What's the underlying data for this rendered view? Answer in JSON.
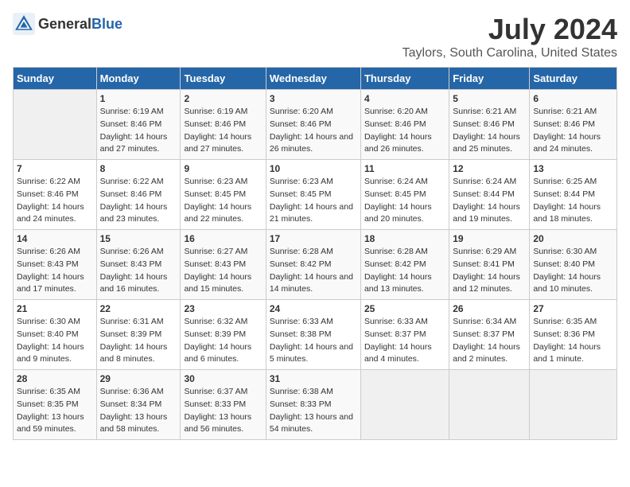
{
  "header": {
    "logo_general": "General",
    "logo_blue": "Blue",
    "title": "July 2024",
    "subtitle": "Taylors, South Carolina, United States"
  },
  "calendar": {
    "days_of_week": [
      "Sunday",
      "Monday",
      "Tuesday",
      "Wednesday",
      "Thursday",
      "Friday",
      "Saturday"
    ],
    "weeks": [
      [
        {
          "day": "",
          "sunrise": "",
          "sunset": "",
          "daylight": ""
        },
        {
          "day": "1",
          "sunrise": "Sunrise: 6:19 AM",
          "sunset": "Sunset: 8:46 PM",
          "daylight": "Daylight: 14 hours and 27 minutes."
        },
        {
          "day": "2",
          "sunrise": "Sunrise: 6:19 AM",
          "sunset": "Sunset: 8:46 PM",
          "daylight": "Daylight: 14 hours and 27 minutes."
        },
        {
          "day": "3",
          "sunrise": "Sunrise: 6:20 AM",
          "sunset": "Sunset: 8:46 PM",
          "daylight": "Daylight: 14 hours and 26 minutes."
        },
        {
          "day": "4",
          "sunrise": "Sunrise: 6:20 AM",
          "sunset": "Sunset: 8:46 PM",
          "daylight": "Daylight: 14 hours and 26 minutes."
        },
        {
          "day": "5",
          "sunrise": "Sunrise: 6:21 AM",
          "sunset": "Sunset: 8:46 PM",
          "daylight": "Daylight: 14 hours and 25 minutes."
        },
        {
          "day": "6",
          "sunrise": "Sunrise: 6:21 AM",
          "sunset": "Sunset: 8:46 PM",
          "daylight": "Daylight: 14 hours and 24 minutes."
        }
      ],
      [
        {
          "day": "7",
          "sunrise": "Sunrise: 6:22 AM",
          "sunset": "Sunset: 8:46 PM",
          "daylight": "Daylight: 14 hours and 24 minutes."
        },
        {
          "day": "8",
          "sunrise": "Sunrise: 6:22 AM",
          "sunset": "Sunset: 8:46 PM",
          "daylight": "Daylight: 14 hours and 23 minutes."
        },
        {
          "day": "9",
          "sunrise": "Sunrise: 6:23 AM",
          "sunset": "Sunset: 8:45 PM",
          "daylight": "Daylight: 14 hours and 22 minutes."
        },
        {
          "day": "10",
          "sunrise": "Sunrise: 6:23 AM",
          "sunset": "Sunset: 8:45 PM",
          "daylight": "Daylight: 14 hours and 21 minutes."
        },
        {
          "day": "11",
          "sunrise": "Sunrise: 6:24 AM",
          "sunset": "Sunset: 8:45 PM",
          "daylight": "Daylight: 14 hours and 20 minutes."
        },
        {
          "day": "12",
          "sunrise": "Sunrise: 6:24 AM",
          "sunset": "Sunset: 8:44 PM",
          "daylight": "Daylight: 14 hours and 19 minutes."
        },
        {
          "day": "13",
          "sunrise": "Sunrise: 6:25 AM",
          "sunset": "Sunset: 8:44 PM",
          "daylight": "Daylight: 14 hours and 18 minutes."
        }
      ],
      [
        {
          "day": "14",
          "sunrise": "Sunrise: 6:26 AM",
          "sunset": "Sunset: 8:43 PM",
          "daylight": "Daylight: 14 hours and 17 minutes."
        },
        {
          "day": "15",
          "sunrise": "Sunrise: 6:26 AM",
          "sunset": "Sunset: 8:43 PM",
          "daylight": "Daylight: 14 hours and 16 minutes."
        },
        {
          "day": "16",
          "sunrise": "Sunrise: 6:27 AM",
          "sunset": "Sunset: 8:43 PM",
          "daylight": "Daylight: 14 hours and 15 minutes."
        },
        {
          "day": "17",
          "sunrise": "Sunrise: 6:28 AM",
          "sunset": "Sunset: 8:42 PM",
          "daylight": "Daylight: 14 hours and 14 minutes."
        },
        {
          "day": "18",
          "sunrise": "Sunrise: 6:28 AM",
          "sunset": "Sunset: 8:42 PM",
          "daylight": "Daylight: 14 hours and 13 minutes."
        },
        {
          "day": "19",
          "sunrise": "Sunrise: 6:29 AM",
          "sunset": "Sunset: 8:41 PM",
          "daylight": "Daylight: 14 hours and 12 minutes."
        },
        {
          "day": "20",
          "sunrise": "Sunrise: 6:30 AM",
          "sunset": "Sunset: 8:40 PM",
          "daylight": "Daylight: 14 hours and 10 minutes."
        }
      ],
      [
        {
          "day": "21",
          "sunrise": "Sunrise: 6:30 AM",
          "sunset": "Sunset: 8:40 PM",
          "daylight": "Daylight: 14 hours and 9 minutes."
        },
        {
          "day": "22",
          "sunrise": "Sunrise: 6:31 AM",
          "sunset": "Sunset: 8:39 PM",
          "daylight": "Daylight: 14 hours and 8 minutes."
        },
        {
          "day": "23",
          "sunrise": "Sunrise: 6:32 AM",
          "sunset": "Sunset: 8:39 PM",
          "daylight": "Daylight: 14 hours and 6 minutes."
        },
        {
          "day": "24",
          "sunrise": "Sunrise: 6:33 AM",
          "sunset": "Sunset: 8:38 PM",
          "daylight": "Daylight: 14 hours and 5 minutes."
        },
        {
          "day": "25",
          "sunrise": "Sunrise: 6:33 AM",
          "sunset": "Sunset: 8:37 PM",
          "daylight": "Daylight: 14 hours and 4 minutes."
        },
        {
          "day": "26",
          "sunrise": "Sunrise: 6:34 AM",
          "sunset": "Sunset: 8:37 PM",
          "daylight": "Daylight: 14 hours and 2 minutes."
        },
        {
          "day": "27",
          "sunrise": "Sunrise: 6:35 AM",
          "sunset": "Sunset: 8:36 PM",
          "daylight": "Daylight: 14 hours and 1 minute."
        }
      ],
      [
        {
          "day": "28",
          "sunrise": "Sunrise: 6:35 AM",
          "sunset": "Sunset: 8:35 PM",
          "daylight": "Daylight: 13 hours and 59 minutes."
        },
        {
          "day": "29",
          "sunrise": "Sunrise: 6:36 AM",
          "sunset": "Sunset: 8:34 PM",
          "daylight": "Daylight: 13 hours and 58 minutes."
        },
        {
          "day": "30",
          "sunrise": "Sunrise: 6:37 AM",
          "sunset": "Sunset: 8:33 PM",
          "daylight": "Daylight: 13 hours and 56 minutes."
        },
        {
          "day": "31",
          "sunrise": "Sunrise: 6:38 AM",
          "sunset": "Sunset: 8:33 PM",
          "daylight": "Daylight: 13 hours and 54 minutes."
        },
        {
          "day": "",
          "sunrise": "",
          "sunset": "",
          "daylight": ""
        },
        {
          "day": "",
          "sunrise": "",
          "sunset": "",
          "daylight": ""
        },
        {
          "day": "",
          "sunrise": "",
          "sunset": "",
          "daylight": ""
        }
      ]
    ]
  }
}
